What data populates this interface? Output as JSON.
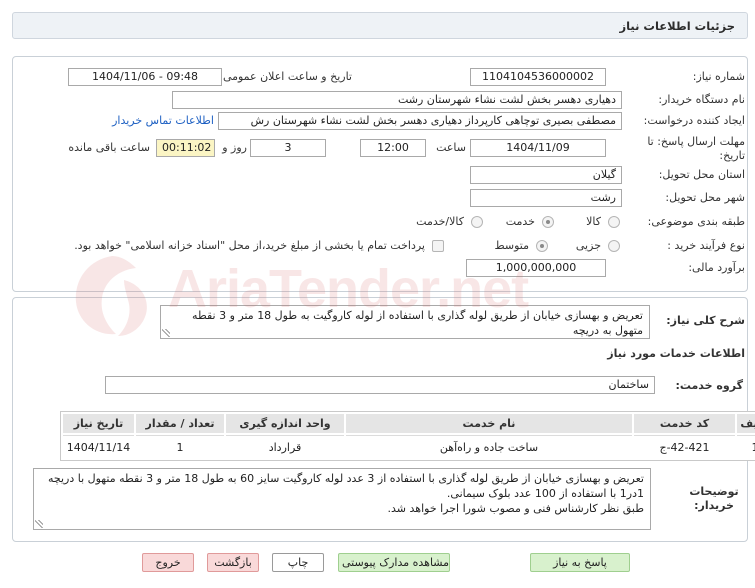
{
  "page": {
    "title": "جزئیات اطلاعات نیاز"
  },
  "need_number": {
    "label": "شماره نیاز:",
    "value": "1104104536000002"
  },
  "announce": {
    "label": "تاریخ و ساعت اعلان عمومی:",
    "value": "1404/11/06 - 09:48"
  },
  "buyer_org": {
    "label": "نام دستگاه خریدار:",
    "value": "دهیاری دهسر بخش لشت نشاء شهرستان رشت"
  },
  "requester": {
    "label": "ایجاد کننده درخواست:",
    "value": "مصطفی بصیری توچاهی کارپرداز دهیاری دهسر بخش لشت نشاء شهرستان رش",
    "contact_link": "اطلاعات تماس خریدار"
  },
  "deadline": {
    "label": "مهلت ارسال پاسخ: تا تاریخ:",
    "date": "1404/11/09",
    "time_label": "ساعت",
    "time": "12:00",
    "days": "3",
    "days_label": "روز و",
    "remaining": "00:11:02",
    "remaining_label": "ساعت باقی مانده"
  },
  "province": {
    "label": "استان محل تحویل:",
    "value": "گیلان"
  },
  "city": {
    "label": "شهر محل تحویل:",
    "value": "رشت"
  },
  "classification": {
    "label": "طبقه بندی موضوعی:",
    "options": [
      {
        "label": "کالا",
        "selected": false
      },
      {
        "label": "خدمت",
        "selected": true
      },
      {
        "label": "کالا/خدمت",
        "selected": false
      }
    ]
  },
  "process": {
    "label": "نوع فرآیند خرید :",
    "options": [
      {
        "label": "جزیی",
        "selected": false
      },
      {
        "label": "متوسط",
        "selected": true
      }
    ],
    "treasury_checkbox": {
      "label": "پرداخت تمام یا بخشی از مبلغ خرید،از محل \"اسناد خزانه اسلامی\" خواهد بود.",
      "checked": false
    }
  },
  "estimate": {
    "label": "برآورد مالی:",
    "value": "1,000,000,000"
  },
  "summary": {
    "label": "شرح کلی نیاز:",
    "value": "تعریض و بهسازی خیابان از طریق لوله گذاری با استفاده از لوله کاروگیت به طول 18 متر و 3 نقطه متهول به دریچه"
  },
  "services": {
    "section_title": "اطلاعات خدمات مورد نیاز",
    "group_label": "گروه خدمت:",
    "group_value": "ساختمان",
    "columns": [
      "ردیف",
      "کد خدمت",
      "نام خدمت",
      "واحد اندازه گیری",
      "تعداد / مقدار",
      "تاریخ نیاز"
    ],
    "rows": [
      {
        "index": "1",
        "code": "ج-42-421",
        "name": "ساخت جاده و راه‌آهن",
        "unit": "قرارداد",
        "quantity": "1",
        "date": "1404/11/14"
      }
    ]
  },
  "buyer_notes": {
    "label": "توضیحات خریدار:",
    "value": "تعریض و بهسازی خیابان از طریق لوله گذاری با استفاده از 3 عدد لوله کاروگیت سایز 60 به طول 18 متر و 3 نقطه متهول با دریچه 1در1 با استفاده از 100 عدد بلوک سیمانی.\nطبق نظر کارشناس فنی و مصوب شورا اجرا خواهد شد."
  },
  "buttons": {
    "respond": "پاسخ به نیاز",
    "attachments": "مشاهده مدارک پیوستی (1)",
    "print": "چاپ",
    "back": "بازگشت",
    "exit": "خروج"
  },
  "watermark": "AriaTender.net",
  "colors": {
    "link": "#1c5fc2",
    "remaining_bg": "#fbf5c4",
    "green_button": "#d8f1cd",
    "pink_button": "#f9d9d9",
    "watermark": "#d66a6a"
  }
}
